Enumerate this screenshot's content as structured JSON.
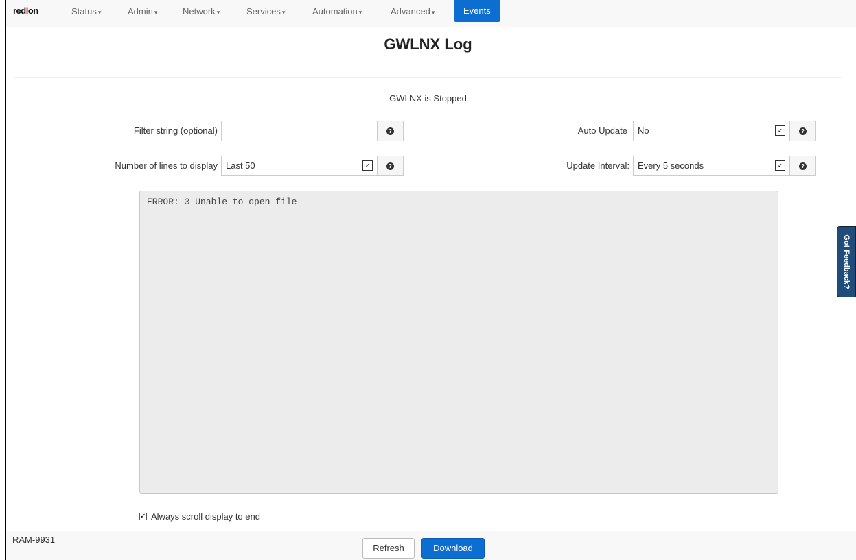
{
  "nav": {
    "brand_a": "red",
    "brand_b": "l",
    "brand_c": "on",
    "items": [
      {
        "label": "Status"
      },
      {
        "label": "Admin"
      },
      {
        "label": "Network"
      },
      {
        "label": "Services"
      },
      {
        "label": "Automation"
      },
      {
        "label": "Advanced"
      },
      {
        "label": "Events"
      }
    ],
    "caret": "▾"
  },
  "page": {
    "title": "GWLNX Log",
    "status": "GWLNX is Stopped"
  },
  "form": {
    "filter_label": "Filter string (optional)",
    "filter_value": "",
    "lines_label": "Number of lines to display",
    "lines_value": "Last 50",
    "auto_update_label": "Auto Update",
    "auto_update_value": "No",
    "interval_label": "Update Interval:",
    "interval_value": "Every 5 seconds",
    "help_glyph": "?",
    "dropdown_glyph": "✓"
  },
  "log": {
    "text": "ERROR: 3 Unable to open file"
  },
  "options": {
    "scroll_label": "Always scroll display to end",
    "scroll_checked_glyph": "✓"
  },
  "footer": {
    "device": "RAM-9931",
    "refresh_label": "Refresh",
    "download_label": "Download"
  },
  "feedback": {
    "label": "Got Feedback?"
  },
  "colors": {
    "accent": "#0d6ed1",
    "feedback_tab": "#1f4c7a"
  }
}
